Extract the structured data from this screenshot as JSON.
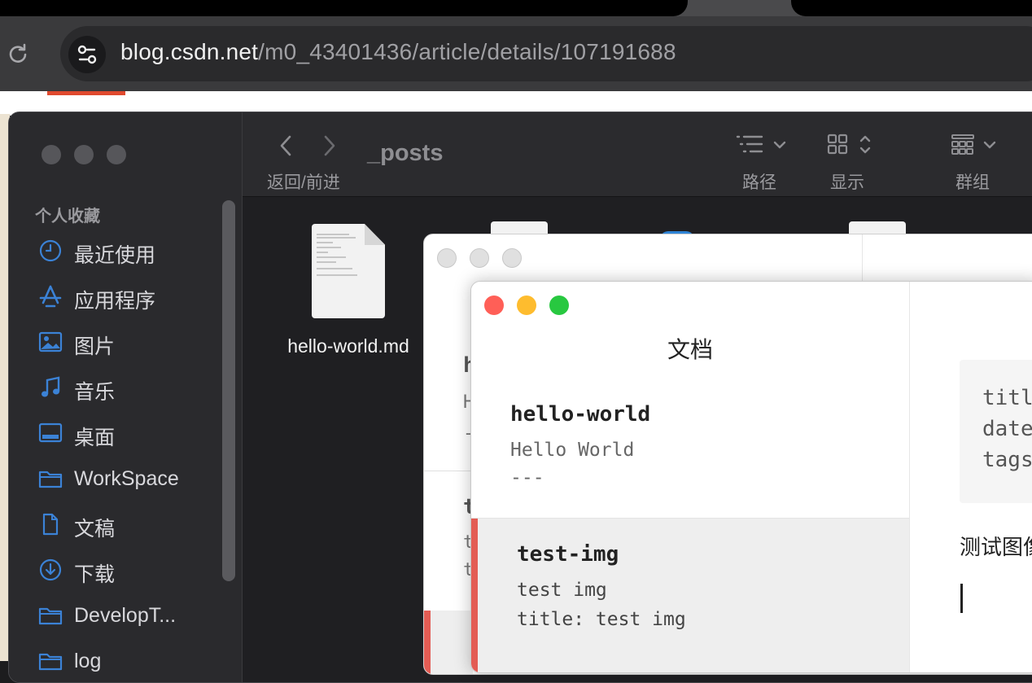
{
  "browser": {
    "url_host": "blog.csdn.net",
    "url_path": "/m0_43401436/article/details/107191688"
  },
  "finder": {
    "folder_title": "_posts",
    "nav_label": "返回/前进",
    "toolbar": {
      "path_label": "路径",
      "display_label": "显示",
      "group_label": "群组"
    },
    "sidebar": {
      "section_title": "个人收藏",
      "items": [
        {
          "label": "最近使用",
          "icon": "clock-icon"
        },
        {
          "label": "应用程序",
          "icon": "apps-icon"
        },
        {
          "label": "图片",
          "icon": "photo-icon"
        },
        {
          "label": "音乐",
          "icon": "music-icon"
        },
        {
          "label": "桌面",
          "icon": "desktop-icon"
        },
        {
          "label": "WorkSpace",
          "icon": "folder-icon"
        },
        {
          "label": "文稿",
          "icon": "document-icon"
        },
        {
          "label": "下载",
          "icon": "download-icon"
        },
        {
          "label": "DevelopT...",
          "icon": "folder-icon"
        },
        {
          "label": "log",
          "icon": "folder-icon"
        }
      ]
    },
    "files": [
      {
        "name": "hello-world.md"
      }
    ]
  },
  "back_window": {
    "partial_lines": [
      "h",
      "H",
      "-",
      "t",
      "t",
      "t"
    ]
  },
  "editor": {
    "panel_title": "文档",
    "documents": [
      {
        "title": "hello-world",
        "line1": "Hello World",
        "line2": "---"
      },
      {
        "title": "test-img",
        "line1": "test img",
        "line2": "title: test img"
      }
    ],
    "content": {
      "code_lines": [
        "titl",
        "date",
        "tags"
      ],
      "body_text": "测试图像"
    }
  },
  "colors": {
    "finder_bg": "#1f1f22",
    "sidebar_bg": "#2a2a2d",
    "accent_blue": "#3b82d6",
    "selection_bar": "#e35c54",
    "traffic_red": "#ff5f57",
    "traffic_yellow": "#febc2e",
    "traffic_green": "#28c840"
  }
}
